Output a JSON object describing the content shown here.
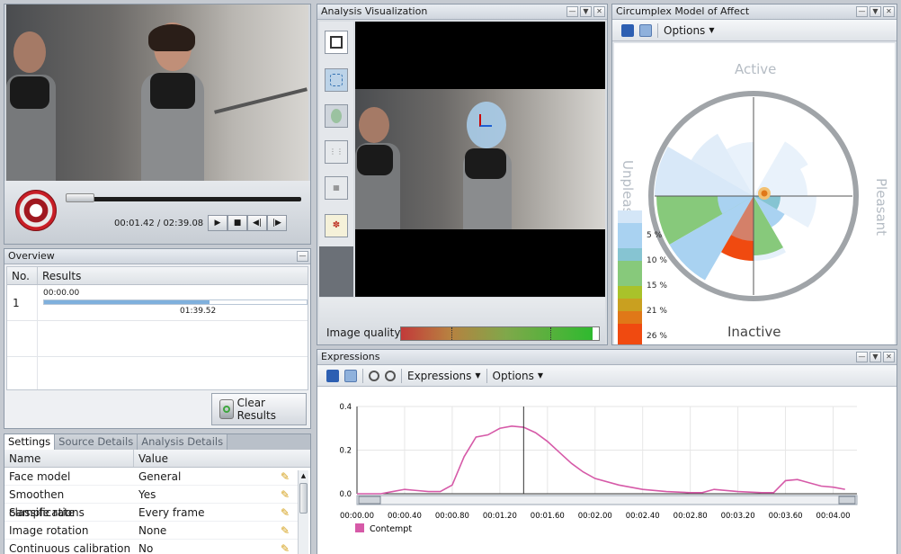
{
  "player": {
    "time_display": "00:01.42 / 02:39.08",
    "controls": [
      "play",
      "stop",
      "step-back",
      "step-forward"
    ]
  },
  "overview": {
    "title": "Overview",
    "columns": [
      "No.",
      "Results"
    ],
    "row": {
      "no": "1",
      "start": "00:00.00",
      "end": "01:39.52"
    },
    "clear_label": "Clear Results"
  },
  "settings": {
    "tabs": [
      "Settings",
      "Source Details",
      "Analysis Details"
    ],
    "columns": [
      "Name",
      "Value"
    ],
    "rows": [
      {
        "name": "Face model",
        "value": "General"
      },
      {
        "name": "Smoothen classifications",
        "value": "Yes"
      },
      {
        "name": "Sample rate",
        "value": "Every frame"
      },
      {
        "name": "Image rotation",
        "value": "None"
      },
      {
        "name": "Continuous calibration",
        "value": "No"
      }
    ]
  },
  "analysis": {
    "title": "Analysis Visualization",
    "quality_label": "Image quality",
    "quality_level": 0.97
  },
  "circumplex": {
    "title": "Circumplex Model of Affect",
    "options_label": "Options",
    "active": "Active",
    "inactive": "Inactive",
    "pleasant": "Pleasant",
    "unpleasant": "Unpleasant",
    "legend": [
      "5 %",
      "10 %",
      "15 %",
      "21 %",
      "26 %"
    ],
    "colors": {
      "c0": "#d4e6f7",
      "c1": "#a9d2f1",
      "c2": "#86c4d2",
      "c3": "#87c97b",
      "c4": "#a9c22a",
      "c5": "#c9a020",
      "c6": "#e07818",
      "c7": "#f04a10"
    }
  },
  "expressions": {
    "title": "Expressions",
    "menu_expressions": "Expressions",
    "menu_options": "Options",
    "legend": "Contempt",
    "color": "#d65aa8"
  },
  "chart_data": {
    "type": "line",
    "series": [
      {
        "name": "Contempt",
        "x": [
          "00:00.00",
          "00:00.20",
          "00:00.30",
          "00:00.40",
          "00:00.50",
          "00:00.60",
          "00:00.70",
          "00:00.80",
          "00:00.90",
          "00:01.00",
          "00:01.10",
          "00:01.20",
          "00:01.30",
          "00:01.40",
          "00:01.50",
          "00:01.60",
          "00:01.70",
          "00:01.80",
          "00:01.90",
          "00:02.00",
          "00:02.20",
          "00:02.40",
          "00:02.60",
          "00:02.80",
          "00:02.90",
          "00:03.00",
          "00:03.20",
          "00:03.40",
          "00:03.50",
          "00:03.60",
          "00:03.70",
          "00:03.80",
          "00:03.90",
          "00:04.00",
          "00:04.10"
        ],
        "values": [
          0.0,
          0.0,
          0.01,
          0.02,
          0.015,
          0.01,
          0.01,
          0.04,
          0.17,
          0.26,
          0.27,
          0.3,
          0.31,
          0.305,
          0.28,
          0.24,
          0.19,
          0.14,
          0.1,
          0.07,
          0.04,
          0.02,
          0.01,
          0.005,
          0.005,
          0.02,
          0.01,
          0.005,
          0.005,
          0.06,
          0.065,
          0.05,
          0.035,
          0.03,
          0.02
        ]
      }
    ],
    "xticks": [
      "00:00.00",
      "00:00.40",
      "00:00.80",
      "00:01.20",
      "00:01.60",
      "00:02.00",
      "00:02.40",
      "00:02.80",
      "00:03.20",
      "00:03.60",
      "00:04.00"
    ],
    "yticks": [
      "0.0",
      "0.2",
      "0.4"
    ],
    "ylim": [
      0,
      0.4
    ],
    "cursor_x": "00:01.40",
    "grid": true,
    "legend_position": "bottom-left"
  }
}
